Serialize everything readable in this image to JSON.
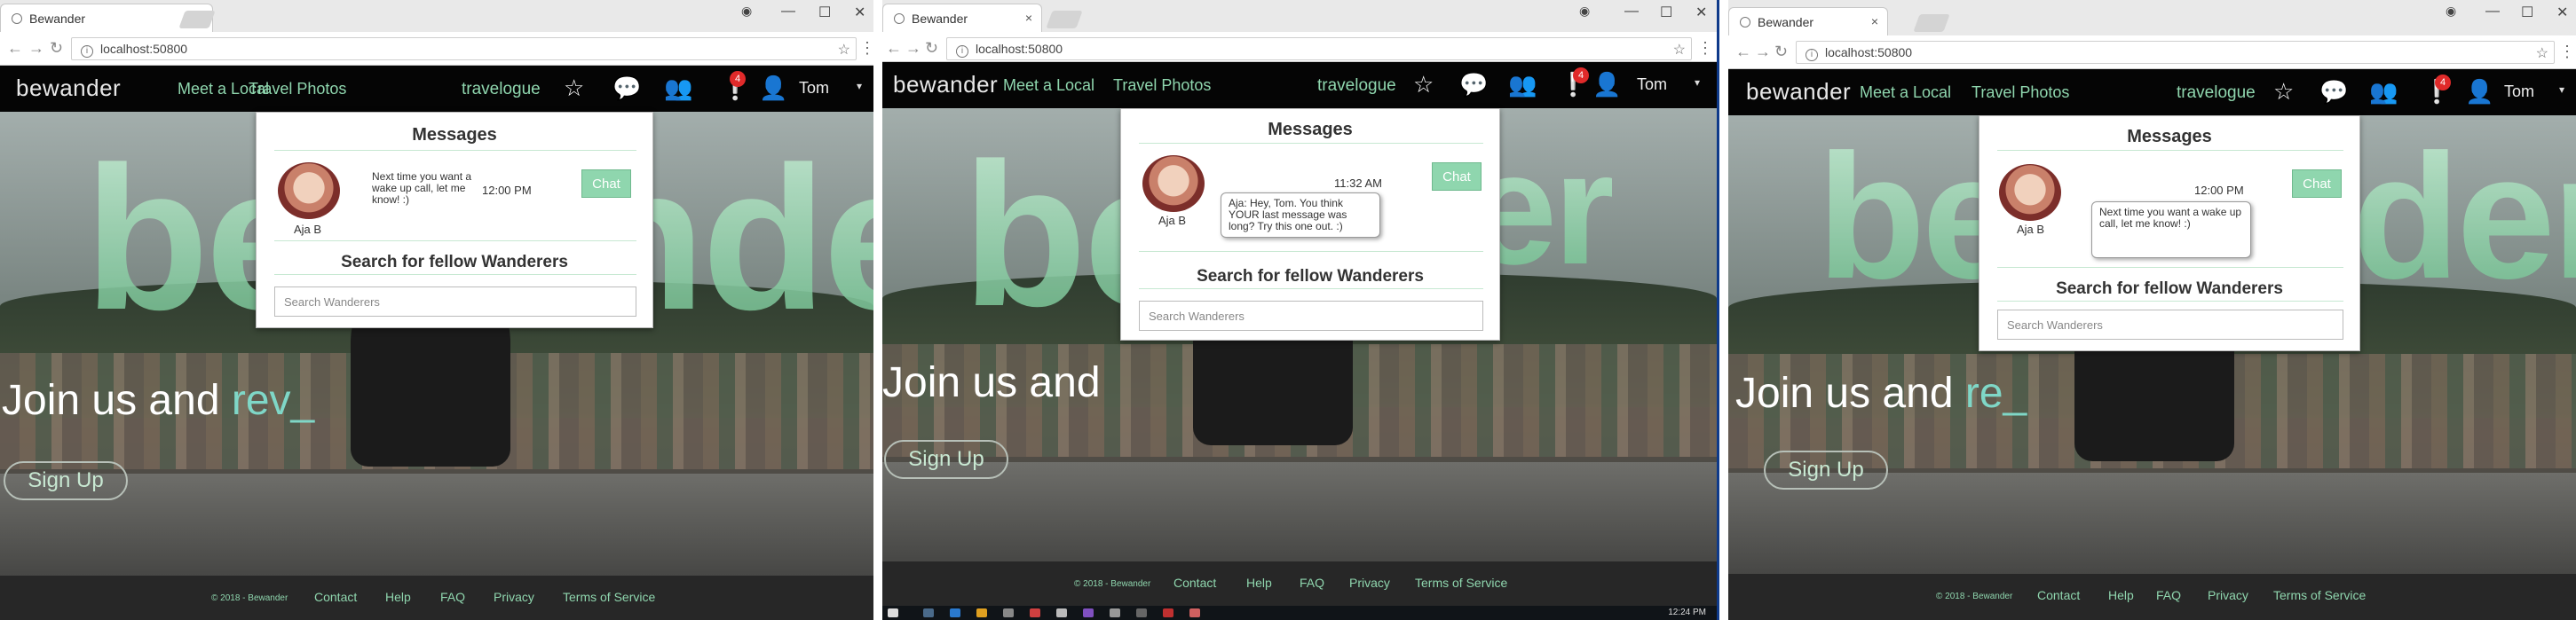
{
  "browser": {
    "tab_title": "Bewander",
    "url": "localhost:50800",
    "close_tab": "×",
    "win_min": "—",
    "win_max": "☐",
    "win_close": "✕"
  },
  "nav": {
    "brand": "bewander",
    "meet_local": "Meet a Local",
    "travel_photos": "Travel Photos",
    "travelogue": "travelogue",
    "notif_count": "4",
    "user_name": "Tom"
  },
  "hero": {
    "big_text_1": "bewander",
    "big_text_2": "bew",
    "join_1": "Join us and ",
    "join_1_accent": "rev_",
    "join_2": "Join us and",
    "join_3": "Join us and ",
    "join_3_accent": "re_",
    "signup": "Sign Up"
  },
  "messages": {
    "title": "Messages",
    "contact_name": "Aja B",
    "panel1_snippet": "Next time you want a wake up call, let me know! :)",
    "panel1_time": "12:00 PM",
    "panel2_time": "11:32 AM",
    "panel2_bubble": "Aja: Hey, Tom. You think YOUR last message was long? Try this one out. :)",
    "panel3_time": "12:00 PM",
    "panel3_bubble": "Next time you want a wake up call, let me know! :)",
    "chat_button": "Chat",
    "search_title": "Search for fellow Wanderers",
    "search_placeholder": "Search Wanderers"
  },
  "footer": {
    "copyright": "© 2018 - Bewander",
    "contact": "Contact",
    "help": "Help",
    "faq": "FAQ",
    "privacy": "Privacy",
    "terms": "Terms of Service"
  },
  "taskbar": {
    "clock": "12:24 PM"
  }
}
